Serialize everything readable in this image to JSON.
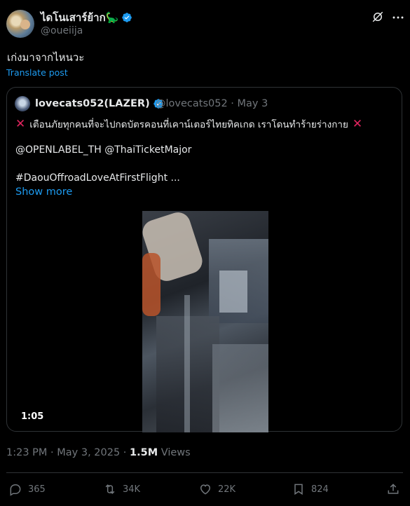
{
  "post": {
    "display_name": "ไดโนเสาร์ย้าก🦕",
    "handle": "@oueiija",
    "text": "เก่งมาจากไหนวะ",
    "translate_label": "Translate post",
    "timestamp": "1:23 PM · May 3, 2025 · ",
    "views_count": "1.5M",
    "views_label": " Views"
  },
  "quote": {
    "display_name": "lovecats052(LAZER)",
    "handle_date": "@lovecats052 · May 3",
    "line1": "เตือนภัยทุกคนที่จะไปกดบัตรคอนที่เคาน์เตอร์ไทยทิคเกด เราโดนทำร้ายร่างกาย",
    "mentions": "@OPENLABEL_TH @ThaiTicketMajor",
    "hashtag": "#DaouOffroadLoveAtFirstFlight ...",
    "show_more": "Show more",
    "video_duration": "1:05"
  },
  "actions": {
    "replies": "365",
    "reposts": "34K",
    "likes": "22K",
    "bookmarks": "824"
  },
  "colors": {
    "accent": "#1d9bf0",
    "muted": "#71767b",
    "alert": "#e0245e"
  }
}
